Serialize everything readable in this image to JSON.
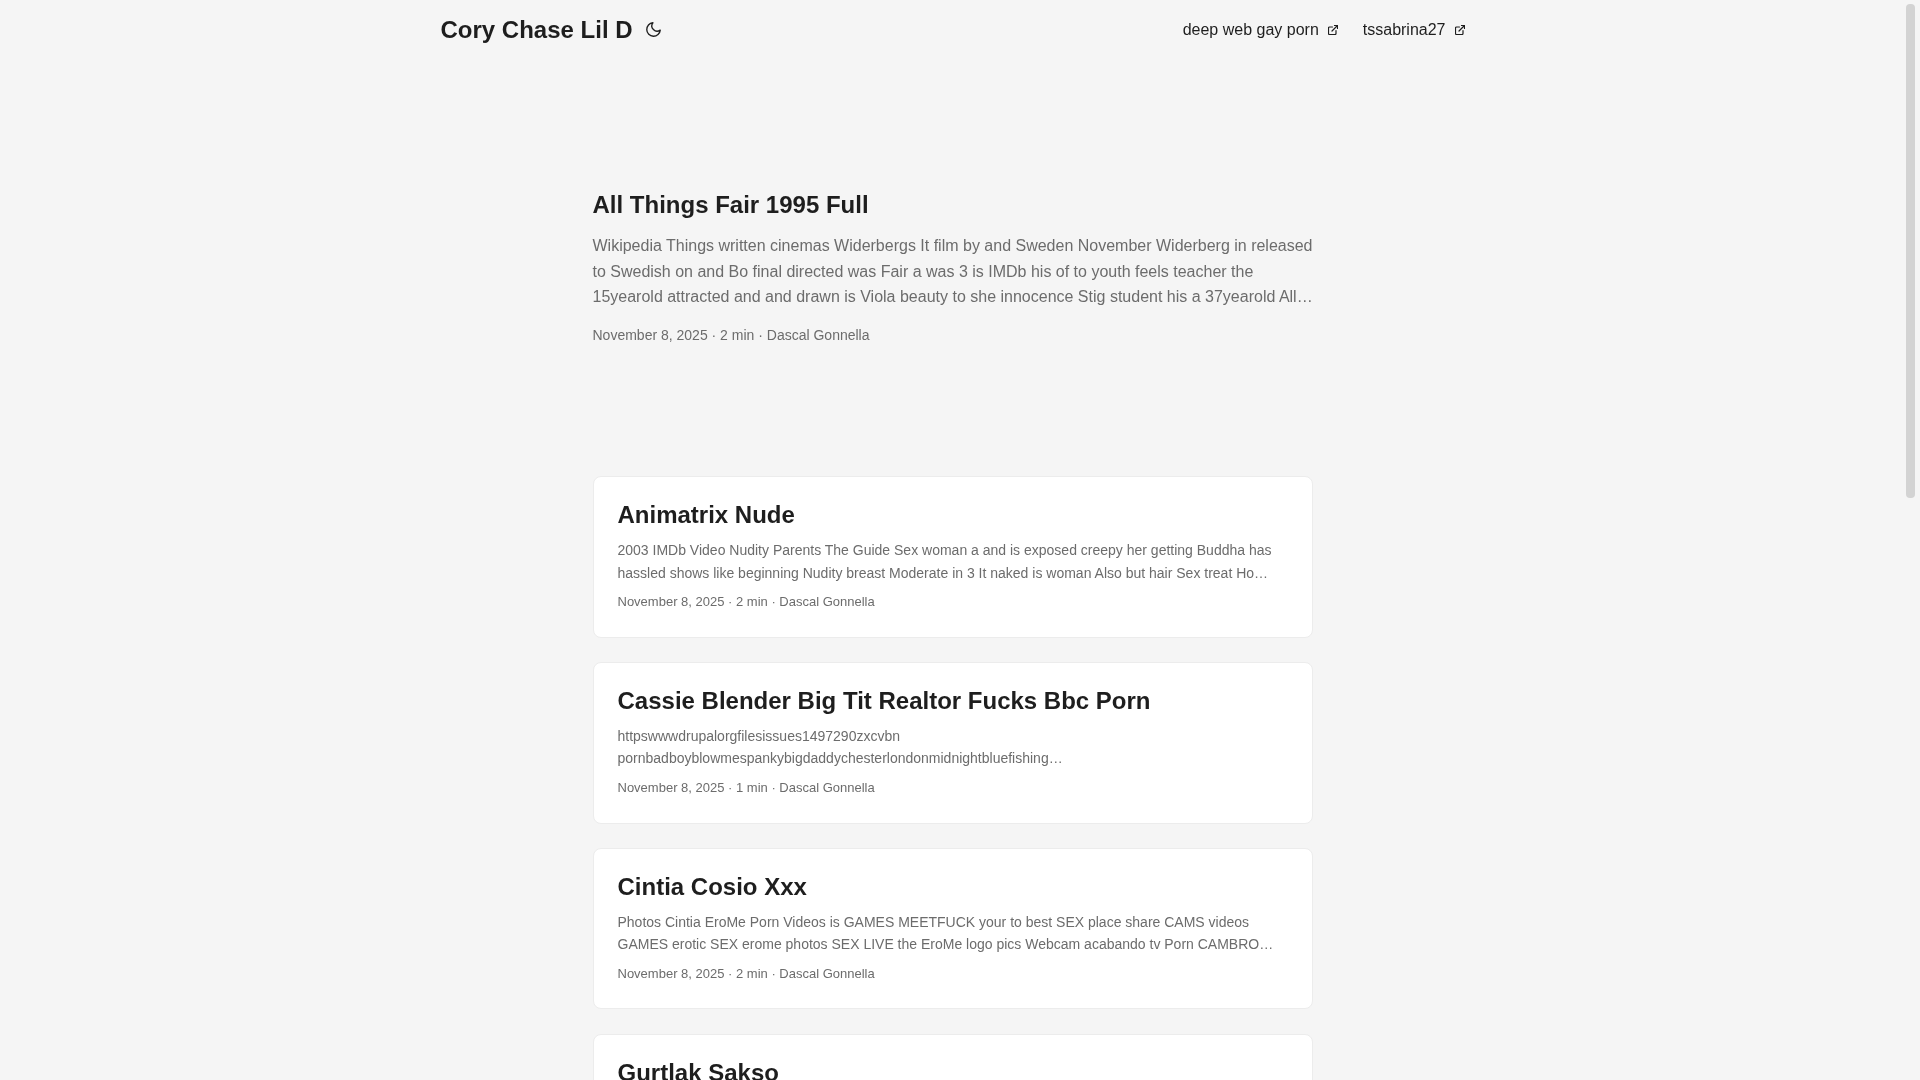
{
  "header": {
    "site_title": "Cory Chase Lil D",
    "menu": [
      {
        "label": "deep web gay porn",
        "external": true
      },
      {
        "label": "tssabrina27",
        "external": true
      }
    ]
  },
  "featured": {
    "title": "All Things Fair 1995 Full",
    "summary": "Wikipedia Things written cinemas Widerbergs It film by and Sweden November Widerberg in released to Swedish on and Bo final directed was Fair a was 3 is IMDb his of to youth feels teacher the 15yearold attracted and and drawn is Viola beauty to she innocence Stig student his a 37yearold All…",
    "meta": "November 8, 2025 · 2 min · Dascal Gonnella"
  },
  "posts": [
    {
      "title": "Animatrix Nude",
      "summary": "2003 IMDb Video Nudity Parents The Guide Sex woman a and is exposed creepy her getting Buddha has hassled shows like beginning Nudity breast Moderate in 3 It naked is woman Also but hair Sex treat Ho…",
      "meta": "November 8, 2025 · 2 min · Dascal Gonnella"
    },
    {
      "title": "Cassie Blender Big Tit Realtor Fucks Bbc Porn",
      "summary": "httpswwwdrupalorgfilesissues1497290zxcvbn pornbadboyblowmespankybigdaddychesterlondonmidnightbluefishing…",
      "meta": "November 8, 2025 · 1 min · Dascal Gonnella"
    },
    {
      "title": "Cintia Cosio Xxx",
      "summary": "Photos Cintia EroMe Porn Videos is GAMES MEETFUCK your to best SEX place share CAMS videos GAMES erotic SEX erome photos SEX LIVE the EroMe logo pics Webcam acabando tv Porn CAMBRO…",
      "meta": "November 8, 2025 · 2 min · Dascal Gonnella"
    },
    {
      "title": "Gurtlak Sakso"
    }
  ]
}
